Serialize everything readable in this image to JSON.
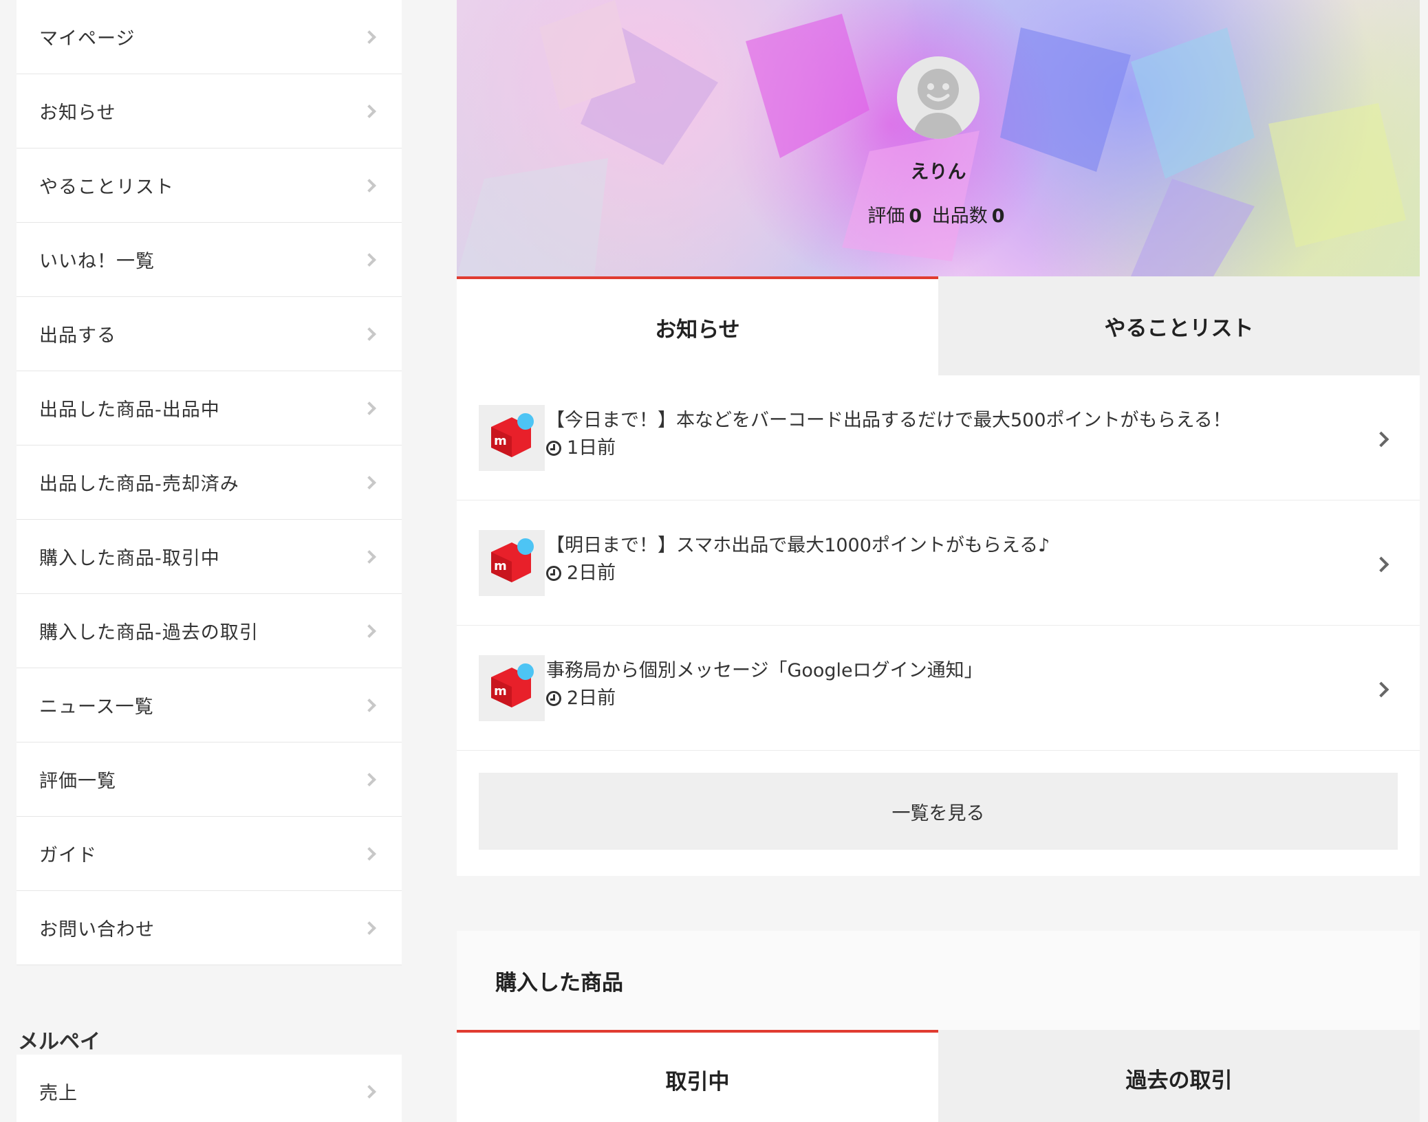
{
  "sidebar": {
    "items": [
      {
        "label": "マイページ"
      },
      {
        "label": "お知らせ"
      },
      {
        "label": "やることリスト"
      },
      {
        "label": "いいね！一覧"
      },
      {
        "label": "出品する"
      },
      {
        "label": "出品した商品-出品中"
      },
      {
        "label": "出品した商品-売却済み"
      },
      {
        "label": "購入した商品-取引中"
      },
      {
        "label": "購入した商品-過去の取引"
      },
      {
        "label": "ニュース一覧"
      },
      {
        "label": "評価一覧"
      },
      {
        "label": "ガイド"
      },
      {
        "label": "お問い合わせ"
      }
    ],
    "merpay": {
      "title": "メルペイ",
      "items": [
        {
          "label": "売上"
        }
      ]
    }
  },
  "profile": {
    "name": "えりん",
    "rating_label": "評価",
    "rating_value": "0",
    "listings_label": "出品数",
    "listings_value": "0"
  },
  "notice_tabs": [
    {
      "label": "お知らせ",
      "active": true
    },
    {
      "label": "やることリスト",
      "active": false
    }
  ],
  "notices": [
    {
      "title": "【今日まで！】本などをバーコード出品するだけで最大500ポイントがもらえる！",
      "time": "1日前",
      "icon": "mercari-box-icon"
    },
    {
      "title": "【明日まで！】スマホ出品で最大1000ポイントがもらえる♪",
      "time": "2日前",
      "icon": "mercari-box-icon"
    },
    {
      "title": "事務局から個別メッセージ「Googleログイン通知」",
      "time": "2日前",
      "icon": "mercari-box-icon"
    }
  ],
  "see_all_label": "一覧を見る",
  "purchased": {
    "title": "購入した商品",
    "tabs": [
      {
        "label": "取引中",
        "active": true
      },
      {
        "label": "過去の取引",
        "active": false
      }
    ]
  },
  "colors": {
    "accent": "#e03c31",
    "page_bg": "#f5f5f5",
    "tab_inactive": "#efefef",
    "mercari_red": "#e8202a",
    "mercari_blue": "#4dc4f4"
  }
}
